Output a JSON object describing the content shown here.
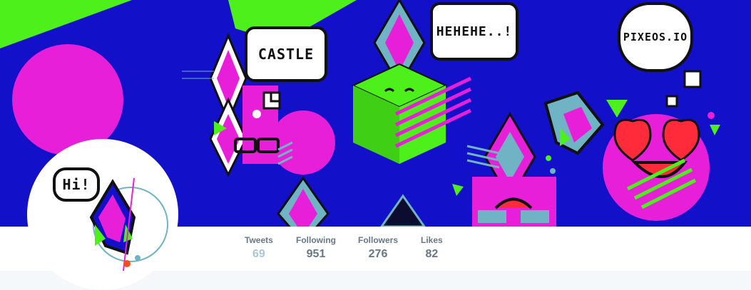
{
  "banner": {
    "bubbles": {
      "castle": "CASTLE",
      "hehehe": "HEHEHE..!",
      "pixeos": "PIXEOS.IO"
    }
  },
  "avatar": {
    "bubble": "Hi!"
  },
  "stats": [
    {
      "label": "Tweets",
      "value": "69"
    },
    {
      "label": "Following",
      "value": "951"
    },
    {
      "label": "Followers",
      "value": "276"
    },
    {
      "label": "Likes",
      "value": "82"
    }
  ],
  "colors": {
    "banner_blue": "#1210c8",
    "magenta": "#e81fd9",
    "lime": "#4ef01c",
    "teal": "#6fb3c4"
  }
}
